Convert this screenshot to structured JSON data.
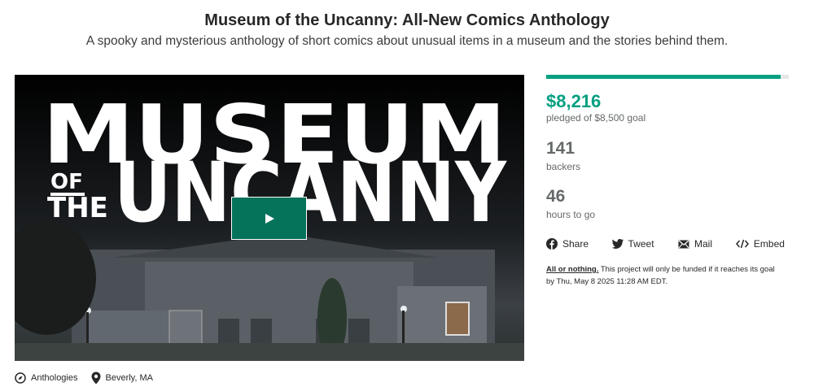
{
  "header": {
    "title": "Museum of the Uncanny: All-New Comics Anthology",
    "subtitle": "A spooky and mysterious anthology of short comics about unusual items in a museum and the stories behind them."
  },
  "video": {
    "art_line1": "MUSEUM",
    "art_small1": "OF",
    "art_small2": "THE",
    "art_line2": "UNCANNY",
    "play_icon": "play-icon"
  },
  "campaign": {
    "progress_fraction": 0.967,
    "accent_color": "#05a081",
    "pledged": "$8,216",
    "pledged_label": "pledged of $8,500 goal",
    "backers": "141",
    "backers_label": "backers",
    "hours": "46",
    "hours_label": "hours to go"
  },
  "share": {
    "items": [
      {
        "label": "Share",
        "icon": "facebook-icon"
      },
      {
        "label": "Tweet",
        "icon": "twitter-icon"
      },
      {
        "label": "Mail",
        "icon": "mail-icon"
      },
      {
        "label": "Embed",
        "icon": "embed-icon"
      }
    ]
  },
  "funding": {
    "link": "All or nothing.",
    "text_line1": " This project will only be funded if it reaches its goal",
    "text_line2": "by Thu, May 8 2025 11:28 AM EDT."
  },
  "meta": {
    "category": "Anthologies",
    "category_icon": "compass-icon",
    "location": "Beverly, MA",
    "location_icon": "location-pin-icon"
  }
}
